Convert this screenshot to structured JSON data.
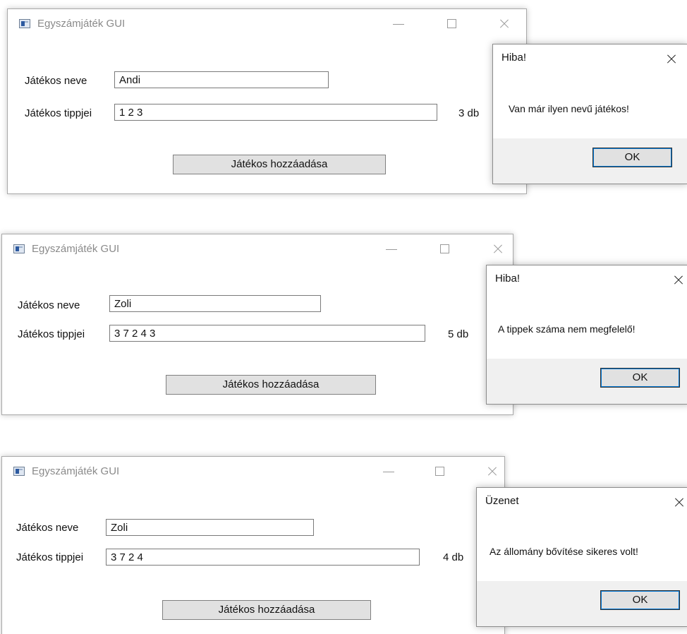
{
  "instances": [
    {
      "window": {
        "title": "Egyszámjáték GUI",
        "name_label": "Játékos neve",
        "name_value": "Andi",
        "tips_label": "Játékos tippjei",
        "tips_value": "1 2 3",
        "count": "3 db",
        "add_button": "Játékos hozzáadása"
      },
      "dialog": {
        "title": "Hiba!",
        "message": "Van már ilyen nevű játékos!",
        "ok": "OK"
      }
    },
    {
      "window": {
        "title": "Egyszámjáték GUI",
        "name_label": "Játékos neve",
        "name_value": "Zoli",
        "tips_label": "Játékos tippjei",
        "tips_value": "3 7 2 4 3",
        "count": "5 db",
        "add_button": "Játékos hozzáadása"
      },
      "dialog": {
        "title": "Hiba!",
        "message": "A tippek száma nem megfelelő!",
        "ok": "OK"
      }
    },
    {
      "window": {
        "title": "Egyszámjáték GUI",
        "name_label": "Játékos neve",
        "name_value": "Zoli",
        "tips_label": "Játékos tippjei",
        "tips_value": "3 7 2 4",
        "count": "4 db",
        "add_button": "Játékos hozzáadása"
      },
      "dialog": {
        "title": "Üzenet",
        "message": "Az állomány bővítése sikeres volt!",
        "ok": "OK"
      }
    }
  ],
  "icons": {
    "app": "app-window-icon",
    "minimize": "minimize-icon",
    "maximize": "maximize-icon",
    "close": "close-icon"
  }
}
